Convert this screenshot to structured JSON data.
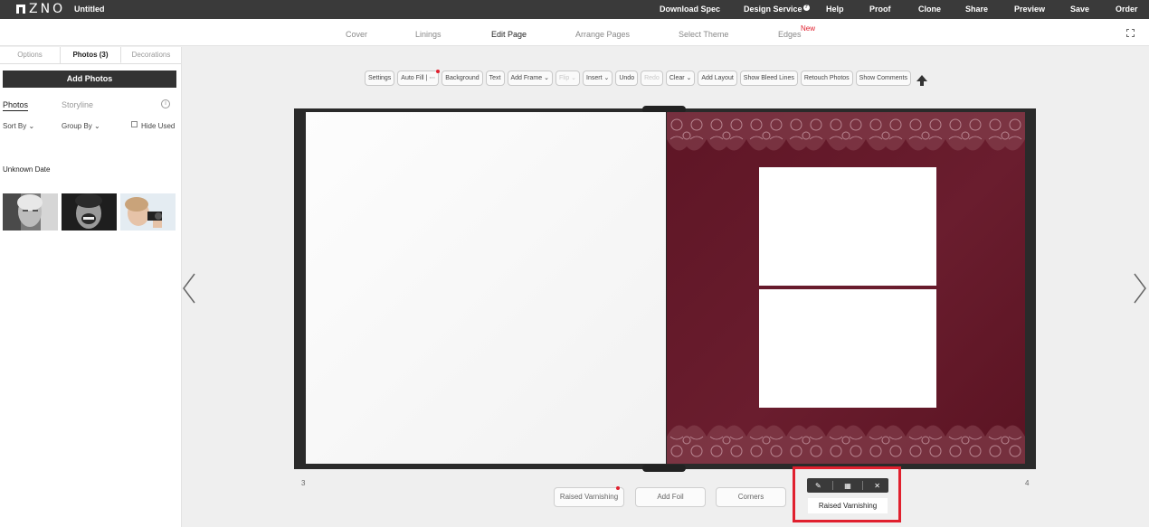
{
  "app": {
    "logo_text": "ZNO",
    "document_title": "Untitled"
  },
  "top_menu": [
    {
      "id": "download-spec",
      "label": "Download Spec"
    },
    {
      "id": "design-service",
      "label": "Design Service"
    },
    {
      "id": "help",
      "label": "Help"
    },
    {
      "id": "proof",
      "label": "Proof"
    },
    {
      "id": "clone",
      "label": "Clone"
    },
    {
      "id": "share",
      "label": "Share"
    },
    {
      "id": "preview",
      "label": "Preview"
    },
    {
      "id": "save",
      "label": "Save"
    },
    {
      "id": "order",
      "label": "Order"
    }
  ],
  "nav_tabs": [
    {
      "id": "cover",
      "label": "Cover"
    },
    {
      "id": "linings",
      "label": "Linings"
    },
    {
      "id": "edit-page",
      "label": "Edit Page",
      "active": true
    },
    {
      "id": "arrange-pages",
      "label": "Arrange Pages"
    },
    {
      "id": "select-theme",
      "label": "Select Theme"
    },
    {
      "id": "edges",
      "label": "Edges",
      "badge": "New"
    }
  ],
  "sidebar": {
    "tabs": [
      {
        "id": "options",
        "label": "Options"
      },
      {
        "id": "photos",
        "label": "Photos (3)",
        "active": true
      },
      {
        "id": "decorations",
        "label": "Decorations"
      }
    ],
    "add_photos_label": "Add Photos",
    "sub_tabs": [
      {
        "id": "photos",
        "label": "Photos",
        "active": true
      },
      {
        "id": "storyline",
        "label": "Storyline"
      }
    ],
    "sort_by_label": "Sort By",
    "group_by_label": "Group By",
    "hide_used_label": "Hide Used",
    "group_heading": "Unknown Date",
    "photos": [
      {
        "id": "elderly-woman"
      },
      {
        "id": "laughing-man"
      },
      {
        "id": "child-camera"
      }
    ]
  },
  "toolbar": [
    {
      "id": "settings",
      "label": "Settings"
    },
    {
      "id": "auto-fill",
      "label": "Auto Fill | ⋯",
      "dot": true
    },
    {
      "id": "background",
      "label": "Background"
    },
    {
      "id": "text",
      "label": "Text"
    },
    {
      "id": "add-frame",
      "label": "Add Frame ⌄"
    },
    {
      "id": "flip",
      "label": "Flip ⌄",
      "disabled": true
    },
    {
      "id": "insert",
      "label": "Insert ⌄"
    },
    {
      "id": "undo",
      "label": "Undo"
    },
    {
      "id": "redo",
      "label": "Redo",
      "disabled": true
    },
    {
      "id": "clear",
      "label": "Clear ⌄"
    },
    {
      "id": "add-layout",
      "label": "Add Layout"
    },
    {
      "id": "show-bleed-lines",
      "label": "Show Bleed Lines"
    },
    {
      "id": "retouch-photos",
      "label": "Retouch Photos"
    },
    {
      "id": "show-comments",
      "label": "Show Comments"
    }
  ],
  "pages": {
    "left_number": "3",
    "right_number": "4"
  },
  "bottom_actions": [
    {
      "id": "raised-varnishing",
      "label": "Raised Varnishing",
      "dot": true
    },
    {
      "id": "add-foil",
      "label": "Add Foil"
    },
    {
      "id": "corners",
      "label": "Corners"
    }
  ],
  "popover": {
    "label": "Raised Varnishing"
  },
  "colors": {
    "topbar": "#3a3a3a",
    "page_right": "#5e1525",
    "accent_red": "#e0202e"
  }
}
